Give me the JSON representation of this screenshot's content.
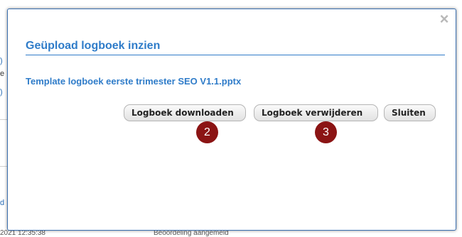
{
  "background": {
    "fragments": [
      ")",
      "e",
      ")",
      "d"
    ],
    "bottom_timestamp": "2021 12:35:38",
    "bottom_message": "Beoordeling aangemeld"
  },
  "dialog": {
    "title": "Geüpload logboek inzien",
    "close_symbol": "×",
    "file_name": "Template logboek eerste trimester SEO V1.1.pptx",
    "buttons": {
      "download": "Logboek downloaden",
      "delete": "Logboek verwijderen",
      "close": "Sluiten"
    },
    "step_badges": {
      "download": "2",
      "delete": "3"
    }
  },
  "colors": {
    "accent": "#2f7cc9",
    "badge": "#8b1414",
    "modal_border": "#3a6fb0"
  }
}
